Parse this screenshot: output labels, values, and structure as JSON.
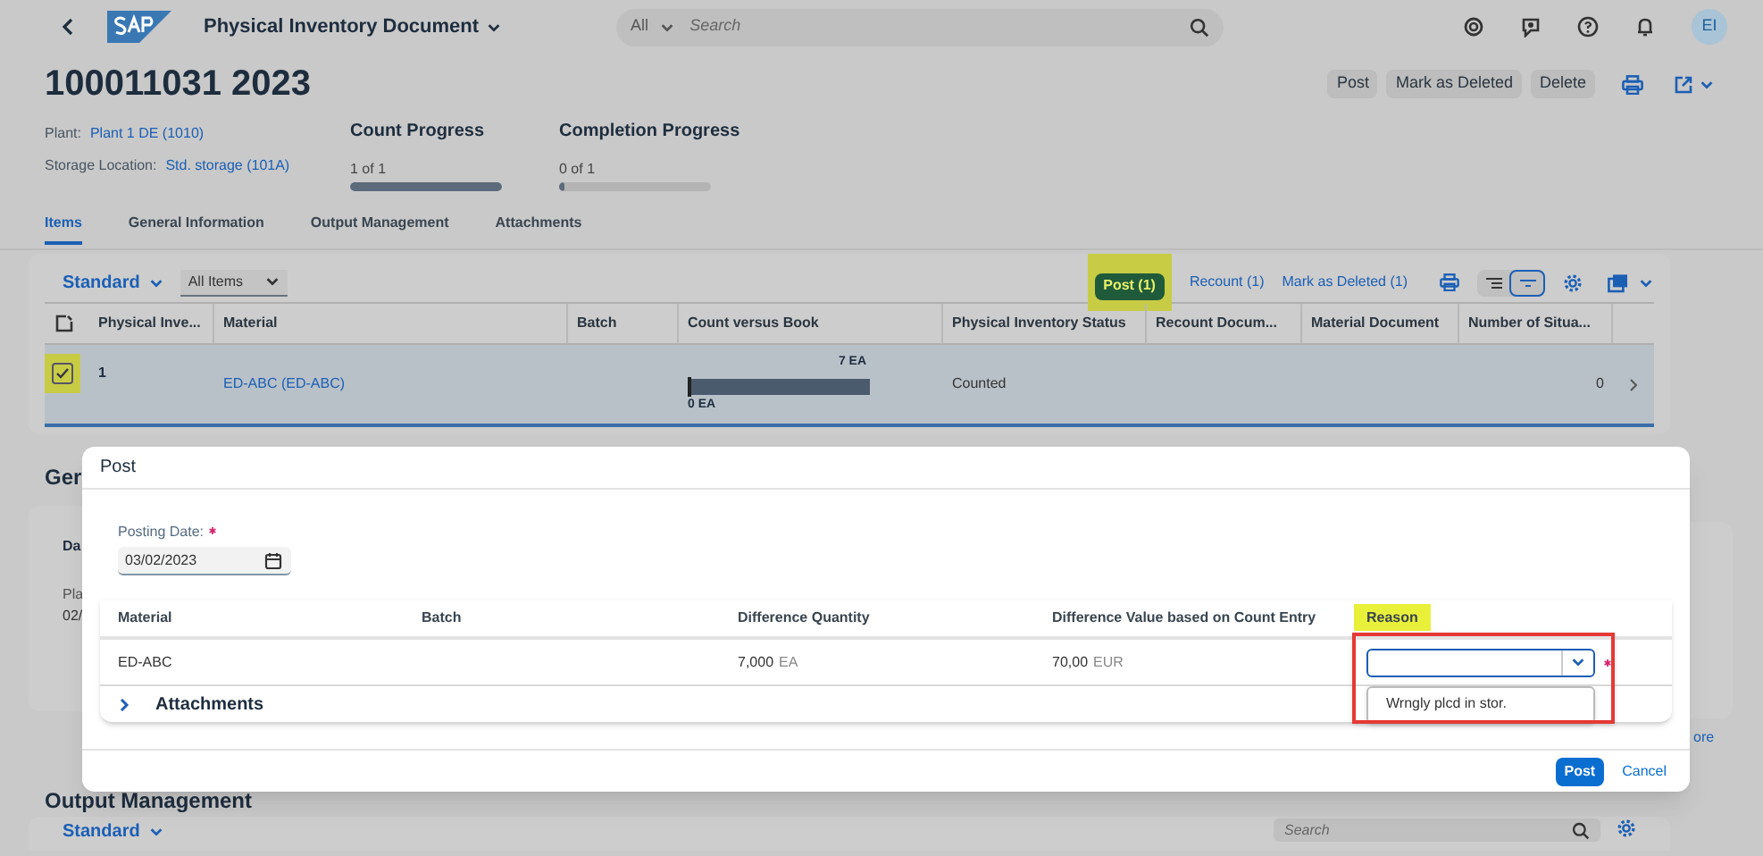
{
  "shell": {
    "title": "Physical Inventory Document",
    "search": {
      "scope": "All",
      "placeholder": "Search"
    },
    "avatar": "EI"
  },
  "header": {
    "title": "100011031 2023",
    "actions": [
      {
        "label": "Post"
      },
      {
        "label": "Mark as Deleted"
      },
      {
        "label": "Delete"
      }
    ],
    "fields": [
      {
        "label": "Plant:",
        "value": "Plant 1 DE (1010)"
      },
      {
        "label": "Storage Location:",
        "value": "Std. storage (101A)"
      }
    ],
    "progress": [
      {
        "title": "Count Progress",
        "reading": "1 of 1",
        "level": 1
      },
      {
        "title": "Completion Progress",
        "reading": "0 of 1",
        "level": 0
      }
    ]
  },
  "tabs": [
    {
      "label": "Items",
      "selected": true
    },
    {
      "label": "General Information",
      "selected": false
    },
    {
      "label": "Output Management",
      "selected": false
    },
    {
      "label": "Attachments",
      "selected": false
    }
  ],
  "items": {
    "variant": "Standard",
    "filter": "All Items",
    "actions": [
      {
        "label": "Post (1)",
        "kind": "emphasized",
        "highlighted": true
      },
      {
        "label": "Recount (1)",
        "kind": "link",
        "highlighted": false
      },
      {
        "label": "Mark as Deleted (1)",
        "kind": "link",
        "highlighted": false
      }
    ],
    "columns": [
      "Physical Inve...",
      "Material",
      "Batch",
      "Count versus Book",
      "Physical Inventory Status",
      "Recount Docum...",
      "Material Document",
      "Number of Situa..."
    ],
    "rows": [
      {
        "selected": true,
        "highlighted": true,
        "item": "1",
        "material": "ED-ABC (ED-ABC)",
        "count_max": "7 EA",
        "count_min": "0 EA",
        "level": 1,
        "status": "Counted",
        "situations": "0"
      }
    ]
  },
  "general_information": {
    "heading": "Ger",
    "label": "Da",
    "field_label": "Pla",
    "field_value": "02/"
  },
  "more_link": "ore",
  "output_management": {
    "heading": "Output Management",
    "variant": "Standard",
    "search": {
      "placeholder": "Search"
    }
  },
  "dialog": {
    "title": "Post",
    "posting_date": {
      "label": "Posting Date:",
      "required": true,
      "value": "03/02/2023"
    },
    "columns": [
      {
        "label": "Material",
        "highlighted": false
      },
      {
        "label": "Batch",
        "highlighted": false
      },
      {
        "label": "Difference Quantity",
        "highlighted": false
      },
      {
        "label": "Difference Value based on Count Entry",
        "highlighted": false
      },
      {
        "label": "Reason",
        "highlighted": true
      }
    ],
    "rows": [
      {
        "material": "ED-ABC",
        "quantity": "7,000",
        "quantity_unit": "EA",
        "value": "70,00",
        "currency": "EUR",
        "reason": {
          "required": true,
          "expanded": true,
          "highlighted": true,
          "options": [
            "Wrngly plcd in stor."
          ]
        }
      }
    ],
    "attachments": {
      "label": "Attachments",
      "expanded": false
    },
    "buttons": [
      {
        "label": "Post",
        "kind": "emphasized"
      },
      {
        "label": "Cancel",
        "kind": "transparent"
      }
    ]
  }
}
